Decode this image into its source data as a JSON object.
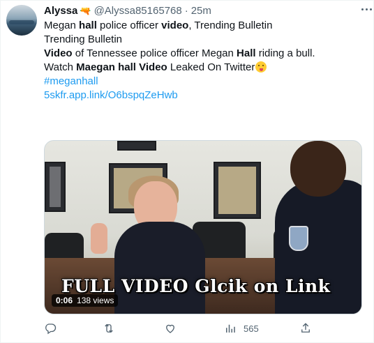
{
  "tweet": {
    "author_name": "Alyssa",
    "author_emoji": "🔫",
    "handle": "@Alyssa85165768",
    "separator": "·",
    "time": "25m",
    "line1": {
      "a": "Megan ",
      "b": "hall",
      "c": " police officer ",
      "d": "video",
      "e": ", Trending Bulletin"
    },
    "line2": "Trending Bulletin",
    "line3": {
      "a": "Video",
      "b": " of Tennessee police officer Megan ",
      "c": "Hall",
      "d": " riding a bull."
    },
    "line4": {
      "a": "Watch ",
      "b": "Maegan hall Video",
      "c": " Leaked On Twitter"
    },
    "hashtag": "#meganhall",
    "url": "5skfr.app.link/O6bspqZeHwb"
  },
  "media": {
    "overlay_text": "FULL VIDEO Glcik on Link",
    "duration": "0:06",
    "views": "138 views"
  },
  "actions": {
    "reply_count": "",
    "retweet_count": "",
    "like_count": "",
    "views_count": "565"
  },
  "colors": {
    "link": "#1d9bf0",
    "muted": "#536471",
    "text": "#0f1419"
  },
  "icons": [
    "more-icon",
    "reply-icon",
    "retweet-icon",
    "like-icon",
    "analytics-icon",
    "share-icon",
    "gun-emoji-icon",
    "tongue-wink-emoji-icon"
  ]
}
